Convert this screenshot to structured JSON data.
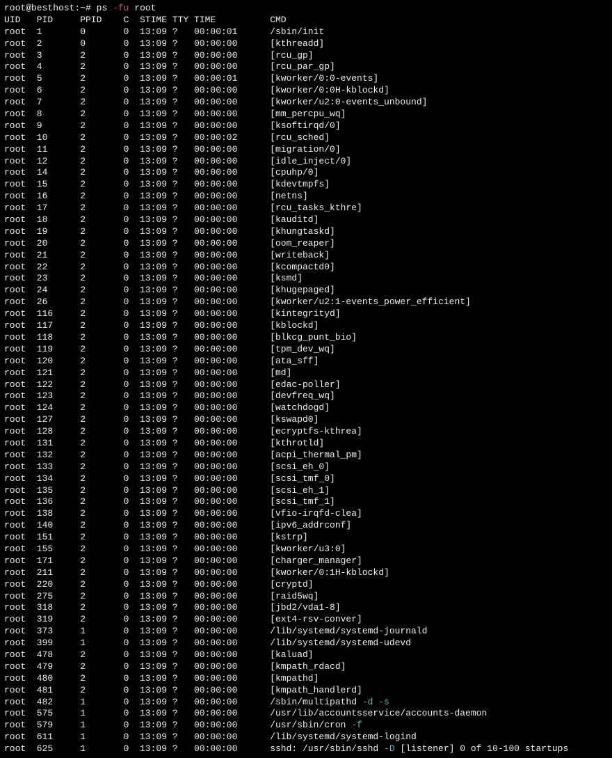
{
  "prompt": {
    "user_host": "root@besthost",
    "sep": ":",
    "path": "~",
    "hash": "# ",
    "cmd": "ps ",
    "flag": "-fu",
    "arg": " root"
  },
  "headers": {
    "uid": "UID",
    "pid": "PID",
    "ppid": "PPID",
    "c": "C",
    "stime": "STIME",
    "tty": "TTY",
    "time": "TIME",
    "cmd": "CMD"
  },
  "rows": [
    {
      "uid": "root",
      "pid": "1",
      "ppid": "0",
      "c": "0",
      "stime": "13:09",
      "tty": "?",
      "time": "00:00:01",
      "cmd": "/sbin/init"
    },
    {
      "uid": "root",
      "pid": "2",
      "ppid": "0",
      "c": "0",
      "stime": "13:09",
      "tty": "?",
      "time": "00:00:00",
      "cmd": "[kthreadd]"
    },
    {
      "uid": "root",
      "pid": "3",
      "ppid": "2",
      "c": "0",
      "stime": "13:09",
      "tty": "?",
      "time": "00:00:00",
      "cmd": "[rcu_gp]"
    },
    {
      "uid": "root",
      "pid": "4",
      "ppid": "2",
      "c": "0",
      "stime": "13:09",
      "tty": "?",
      "time": "00:00:00",
      "cmd": "[rcu_par_gp]"
    },
    {
      "uid": "root",
      "pid": "5",
      "ppid": "2",
      "c": "0",
      "stime": "13:09",
      "tty": "?",
      "time": "00:00:01",
      "cmd": "[kworker/0:0-events]"
    },
    {
      "uid": "root",
      "pid": "6",
      "ppid": "2",
      "c": "0",
      "stime": "13:09",
      "tty": "?",
      "time": "00:00:00",
      "cmd": "[kworker/0:0H-kblockd]"
    },
    {
      "uid": "root",
      "pid": "7",
      "ppid": "2",
      "c": "0",
      "stime": "13:09",
      "tty": "?",
      "time": "00:00:00",
      "cmd": "[kworker/u2:0-events_unbound]"
    },
    {
      "uid": "root",
      "pid": "8",
      "ppid": "2",
      "c": "0",
      "stime": "13:09",
      "tty": "?",
      "time": "00:00:00",
      "cmd": "[mm_percpu_wq]"
    },
    {
      "uid": "root",
      "pid": "9",
      "ppid": "2",
      "c": "0",
      "stime": "13:09",
      "tty": "?",
      "time": "00:00:00",
      "cmd": "[ksoftirqd/0]"
    },
    {
      "uid": "root",
      "pid": "10",
      "ppid": "2",
      "c": "0",
      "stime": "13:09",
      "tty": "?",
      "time": "00:00:02",
      "cmd": "[rcu_sched]"
    },
    {
      "uid": "root",
      "pid": "11",
      "ppid": "2",
      "c": "0",
      "stime": "13:09",
      "tty": "?",
      "time": "00:00:00",
      "cmd": "[migration/0]"
    },
    {
      "uid": "root",
      "pid": "12",
      "ppid": "2",
      "c": "0",
      "stime": "13:09",
      "tty": "?",
      "time": "00:00:00",
      "cmd": "[idle_inject/0]"
    },
    {
      "uid": "root",
      "pid": "14",
      "ppid": "2",
      "c": "0",
      "stime": "13:09",
      "tty": "?",
      "time": "00:00:00",
      "cmd": "[cpuhp/0]"
    },
    {
      "uid": "root",
      "pid": "15",
      "ppid": "2",
      "c": "0",
      "stime": "13:09",
      "tty": "?",
      "time": "00:00:00",
      "cmd": "[kdevtmpfs]"
    },
    {
      "uid": "root",
      "pid": "16",
      "ppid": "2",
      "c": "0",
      "stime": "13:09",
      "tty": "?",
      "time": "00:00:00",
      "cmd": "[netns]"
    },
    {
      "uid": "root",
      "pid": "17",
      "ppid": "2",
      "c": "0",
      "stime": "13:09",
      "tty": "?",
      "time": "00:00:00",
      "cmd": "[rcu_tasks_kthre]"
    },
    {
      "uid": "root",
      "pid": "18",
      "ppid": "2",
      "c": "0",
      "stime": "13:09",
      "tty": "?",
      "time": "00:00:00",
      "cmd": "[kauditd]"
    },
    {
      "uid": "root",
      "pid": "19",
      "ppid": "2",
      "c": "0",
      "stime": "13:09",
      "tty": "?",
      "time": "00:00:00",
      "cmd": "[khungtaskd]"
    },
    {
      "uid": "root",
      "pid": "20",
      "ppid": "2",
      "c": "0",
      "stime": "13:09",
      "tty": "?",
      "time": "00:00:00",
      "cmd": "[oom_reaper]"
    },
    {
      "uid": "root",
      "pid": "21",
      "ppid": "2",
      "c": "0",
      "stime": "13:09",
      "tty": "?",
      "time": "00:00:00",
      "cmd": "[writeback]"
    },
    {
      "uid": "root",
      "pid": "22",
      "ppid": "2",
      "c": "0",
      "stime": "13:09",
      "tty": "?",
      "time": "00:00:00",
      "cmd": "[kcompactd0]"
    },
    {
      "uid": "root",
      "pid": "23",
      "ppid": "2",
      "c": "0",
      "stime": "13:09",
      "tty": "?",
      "time": "00:00:00",
      "cmd": "[ksmd]"
    },
    {
      "uid": "root",
      "pid": "24",
      "ppid": "2",
      "c": "0",
      "stime": "13:09",
      "tty": "?",
      "time": "00:00:00",
      "cmd": "[khugepaged]"
    },
    {
      "uid": "root",
      "pid": "26",
      "ppid": "2",
      "c": "0",
      "stime": "13:09",
      "tty": "?",
      "time": "00:00:00",
      "cmd": "[kworker/u2:1-events_power_efficient]"
    },
    {
      "uid": "root",
      "pid": "116",
      "ppid": "2",
      "c": "0",
      "stime": "13:09",
      "tty": "?",
      "time": "00:00:00",
      "cmd": "[kintegrityd]"
    },
    {
      "uid": "root",
      "pid": "117",
      "ppid": "2",
      "c": "0",
      "stime": "13:09",
      "tty": "?",
      "time": "00:00:00",
      "cmd": "[kblockd]"
    },
    {
      "uid": "root",
      "pid": "118",
      "ppid": "2",
      "c": "0",
      "stime": "13:09",
      "tty": "?",
      "time": "00:00:00",
      "cmd": "[blkcg_punt_bio]"
    },
    {
      "uid": "root",
      "pid": "119",
      "ppid": "2",
      "c": "0",
      "stime": "13:09",
      "tty": "?",
      "time": "00:00:00",
      "cmd": "[tpm_dev_wq]"
    },
    {
      "uid": "root",
      "pid": "120",
      "ppid": "2",
      "c": "0",
      "stime": "13:09",
      "tty": "?",
      "time": "00:00:00",
      "cmd": "[ata_sff]"
    },
    {
      "uid": "root",
      "pid": "121",
      "ppid": "2",
      "c": "0",
      "stime": "13:09",
      "tty": "?",
      "time": "00:00:00",
      "cmd": "[md]"
    },
    {
      "uid": "root",
      "pid": "122",
      "ppid": "2",
      "c": "0",
      "stime": "13:09",
      "tty": "?",
      "time": "00:00:00",
      "cmd": "[edac-poller]"
    },
    {
      "uid": "root",
      "pid": "123",
      "ppid": "2",
      "c": "0",
      "stime": "13:09",
      "tty": "?",
      "time": "00:00:00",
      "cmd": "[devfreq_wq]"
    },
    {
      "uid": "root",
      "pid": "124",
      "ppid": "2",
      "c": "0",
      "stime": "13:09",
      "tty": "?",
      "time": "00:00:00",
      "cmd": "[watchdogd]"
    },
    {
      "uid": "root",
      "pid": "127",
      "ppid": "2",
      "c": "0",
      "stime": "13:09",
      "tty": "?",
      "time": "00:00:00",
      "cmd": "[kswapd0]"
    },
    {
      "uid": "root",
      "pid": "128",
      "ppid": "2",
      "c": "0",
      "stime": "13:09",
      "tty": "?",
      "time": "00:00:00",
      "cmd": "[ecryptfs-kthrea]"
    },
    {
      "uid": "root",
      "pid": "131",
      "ppid": "2",
      "c": "0",
      "stime": "13:09",
      "tty": "?",
      "time": "00:00:00",
      "cmd": "[kthrotld]"
    },
    {
      "uid": "root",
      "pid": "132",
      "ppid": "2",
      "c": "0",
      "stime": "13:09",
      "tty": "?",
      "time": "00:00:00",
      "cmd": "[acpi_thermal_pm]"
    },
    {
      "uid": "root",
      "pid": "133",
      "ppid": "2",
      "c": "0",
      "stime": "13:09",
      "tty": "?",
      "time": "00:00:00",
      "cmd": "[scsi_eh_0]"
    },
    {
      "uid": "root",
      "pid": "134",
      "ppid": "2",
      "c": "0",
      "stime": "13:09",
      "tty": "?",
      "time": "00:00:00",
      "cmd": "[scsi_tmf_0]"
    },
    {
      "uid": "root",
      "pid": "135",
      "ppid": "2",
      "c": "0",
      "stime": "13:09",
      "tty": "?",
      "time": "00:00:00",
      "cmd": "[scsi_eh_1]"
    },
    {
      "uid": "root",
      "pid": "136",
      "ppid": "2",
      "c": "0",
      "stime": "13:09",
      "tty": "?",
      "time": "00:00:00",
      "cmd": "[scsi_tmf_1]"
    },
    {
      "uid": "root",
      "pid": "138",
      "ppid": "2",
      "c": "0",
      "stime": "13:09",
      "tty": "?",
      "time": "00:00:00",
      "cmd": "[vfio-irqfd-clea]"
    },
    {
      "uid": "root",
      "pid": "140",
      "ppid": "2",
      "c": "0",
      "stime": "13:09",
      "tty": "?",
      "time": "00:00:00",
      "cmd": "[ipv6_addrconf]"
    },
    {
      "uid": "root",
      "pid": "151",
      "ppid": "2",
      "c": "0",
      "stime": "13:09",
      "tty": "?",
      "time": "00:00:00",
      "cmd": "[kstrp]"
    },
    {
      "uid": "root",
      "pid": "155",
      "ppid": "2",
      "c": "0",
      "stime": "13:09",
      "tty": "?",
      "time": "00:00:00",
      "cmd": "[kworker/u3:0]"
    },
    {
      "uid": "root",
      "pid": "171",
      "ppid": "2",
      "c": "0",
      "stime": "13:09",
      "tty": "?",
      "time": "00:00:00",
      "cmd": "[charger_manager]"
    },
    {
      "uid": "root",
      "pid": "211",
      "ppid": "2",
      "c": "0",
      "stime": "13:09",
      "tty": "?",
      "time": "00:00:00",
      "cmd": "[kworker/0:1H-kblockd]"
    },
    {
      "uid": "root",
      "pid": "220",
      "ppid": "2",
      "c": "0",
      "stime": "13:09",
      "tty": "?",
      "time": "00:00:00",
      "cmd": "[cryptd]"
    },
    {
      "uid": "root",
      "pid": "275",
      "ppid": "2",
      "c": "0",
      "stime": "13:09",
      "tty": "?",
      "time": "00:00:00",
      "cmd": "[raid5wq]"
    },
    {
      "uid": "root",
      "pid": "318",
      "ppid": "2",
      "c": "0",
      "stime": "13:09",
      "tty": "?",
      "time": "00:00:00",
      "cmd": "[jbd2/vda1-8]"
    },
    {
      "uid": "root",
      "pid": "319",
      "ppid": "2",
      "c": "0",
      "stime": "13:09",
      "tty": "?",
      "time": "00:00:00",
      "cmd": "[ext4-rsv-conver]"
    },
    {
      "uid": "root",
      "pid": "373",
      "ppid": "1",
      "c": "0",
      "stime": "13:09",
      "tty": "?",
      "time": "00:00:00",
      "cmd": "/lib/systemd/systemd-journald"
    },
    {
      "uid": "root",
      "pid": "399",
      "ppid": "1",
      "c": "0",
      "stime": "13:09",
      "tty": "?",
      "time": "00:00:00",
      "cmd": "/lib/systemd/systemd-udevd"
    },
    {
      "uid": "root",
      "pid": "478",
      "ppid": "2",
      "c": "0",
      "stime": "13:09",
      "tty": "?",
      "time": "00:00:00",
      "cmd": "[kaluad]"
    },
    {
      "uid": "root",
      "pid": "479",
      "ppid": "2",
      "c": "0",
      "stime": "13:09",
      "tty": "?",
      "time": "00:00:00",
      "cmd": "[kmpath_rdacd]"
    },
    {
      "uid": "root",
      "pid": "480",
      "ppid": "2",
      "c": "0",
      "stime": "13:09",
      "tty": "?",
      "time": "00:00:00",
      "cmd": "[kmpathd]"
    },
    {
      "uid": "root",
      "pid": "481",
      "ppid": "2",
      "c": "0",
      "stime": "13:09",
      "tty": "?",
      "time": "00:00:00",
      "cmd": "[kmpath_handlerd]"
    },
    {
      "uid": "root",
      "pid": "482",
      "ppid": "1",
      "c": "0",
      "stime": "13:09",
      "tty": "?",
      "time": "00:00:00",
      "cmd_parts": [
        {
          "t": "/sbin/multipathd "
        },
        {
          "t": "-d",
          "cls": "cyan"
        },
        {
          "t": " "
        },
        {
          "t": "-s",
          "cls": "cyan"
        }
      ]
    },
    {
      "uid": "root",
      "pid": "575",
      "ppid": "1",
      "c": "0",
      "stime": "13:09",
      "tty": "?",
      "time": "00:00:00",
      "cmd": "/usr/lib/accountsservice/accounts-daemon"
    },
    {
      "uid": "root",
      "pid": "579",
      "ppid": "1",
      "c": "0",
      "stime": "13:09",
      "tty": "?",
      "time": "00:00:00",
      "cmd_parts": [
        {
          "t": "/usr/sbin/cron "
        },
        {
          "t": "-f",
          "cls": "cyan"
        }
      ]
    },
    {
      "uid": "root",
      "pid": "611",
      "ppid": "1",
      "c": "0",
      "stime": "13:09",
      "tty": "?",
      "time": "00:00:00",
      "cmd": "/lib/systemd/systemd-logind"
    },
    {
      "uid": "root",
      "pid": "625",
      "ppid": "1",
      "c": "0",
      "stime": "13:09",
      "tty": "?",
      "time": "00:00:00",
      "cmd_parts": [
        {
          "t": "sshd: /usr/sbin/sshd "
        },
        {
          "t": "-D",
          "cls": "cyan"
        },
        {
          "t": " [listener] 0 of 10-100 startups"
        }
      ]
    }
  ]
}
